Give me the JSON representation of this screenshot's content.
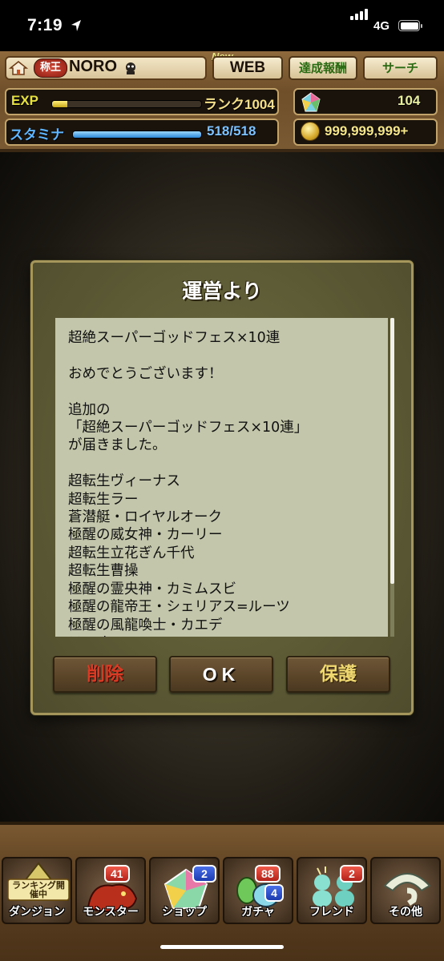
{
  "status_bar": {
    "time": "7:19",
    "network": "4G"
  },
  "header": {
    "title_badge": "称王",
    "player_name": "NORO",
    "new_tag": "New",
    "web_button": "WEB",
    "achievement_button": "達成報酬",
    "search_button": "サーチ",
    "exp_label": "EXP",
    "exp_progress": 0.1,
    "rank_text": "ランク1004",
    "stamina_label": "スタミナ",
    "stamina_progress": 1.0,
    "stamina_value": "518/518",
    "magic_stones": "104",
    "coins": "999,999,999+"
  },
  "dialog": {
    "title": "運営より",
    "message": "超絶スーパーゴッドフェス×10連\n\nおめでとうございます！\n\n追加の\n「超絶スーパーゴッドフェス×10連」\nが届きました。\n\n超転生ヴィーナス\n超転生ラー\n蒼潜艇・ロイヤルオーク\n極醒の威女神・カーリー\n超転生立花ぎん千代\n超転生曹操\n極醒の霊央神・カミムスビ\n極醒の龍帝王・シェリアス=ルーツ\n極醒の風龍喚士・カエデ\nテュオレ",
    "buttons": {
      "delete": "削除",
      "ok": "OK",
      "protect": "保護"
    }
  },
  "bottom_nav": {
    "items": [
      {
        "label": "ダンジョン",
        "banner": "ランキング開催中",
        "badge": ""
      },
      {
        "label": "モンスター",
        "badge": "41"
      },
      {
        "label": "ショップ",
        "badge": "2"
      },
      {
        "label": "ガチャ",
        "badge": "88",
        "badge2": "4"
      },
      {
        "label": "フレンド",
        "badge": "2"
      },
      {
        "label": "その他",
        "badge": ""
      }
    ]
  },
  "colors": {
    "dialog_bg": "#5e5c36",
    "message_bg": "#c3c6aa",
    "delete_text": "#d83a24",
    "protect_text": "#f0d870",
    "exp_bar": "#e6e040",
    "stamina_bar": "#4aa6f0"
  }
}
